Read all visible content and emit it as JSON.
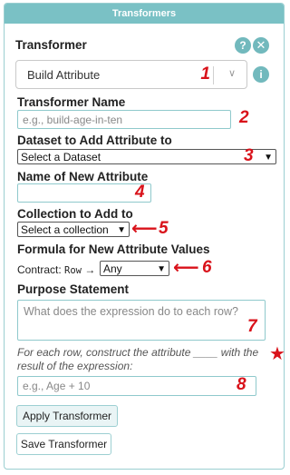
{
  "header": {
    "title": "Transformers"
  },
  "transformer": {
    "label": "Transformer",
    "help_icon": "question-icon",
    "close_icon": "close-icon",
    "selected": "Build Attribute",
    "info_icon": "info-icon"
  },
  "fields": {
    "name": {
      "label": "Transformer Name",
      "placeholder": "e.g., build-age-in-ten"
    },
    "dataset": {
      "label": "Dataset to Add Attribute to",
      "value": "Select a Dataset"
    },
    "new_attr": {
      "label": "Name of New Attribute",
      "value": ""
    },
    "collection": {
      "label": "Collection to Add to",
      "value": "Select a collection"
    },
    "formula": {
      "label": "Formula for New Attribute Values",
      "contract_prefix": "Contract:",
      "contract_code": "Row",
      "contract_arrow": "→",
      "type_value": "Any"
    },
    "purpose": {
      "label": "Purpose Statement",
      "placeholder": "What does the expression do to each row?"
    },
    "description": "For each row, construct the attribute ____ with the result of the expression:",
    "expression": {
      "placeholder": "e.g., Age + 10"
    }
  },
  "buttons": {
    "apply": "Apply Transformer",
    "save": "Save Transformer"
  },
  "annotations": {
    "n1": "1",
    "n2": "2",
    "n3": "3",
    "n4": "4",
    "n5": "5",
    "n6": "6",
    "n7": "7",
    "n8": "8",
    "star": "★",
    "arrow": "⟵"
  },
  "colors": {
    "header": "#7ac1c5",
    "accent": "#72b9bd",
    "annotation": "#d9121a"
  }
}
